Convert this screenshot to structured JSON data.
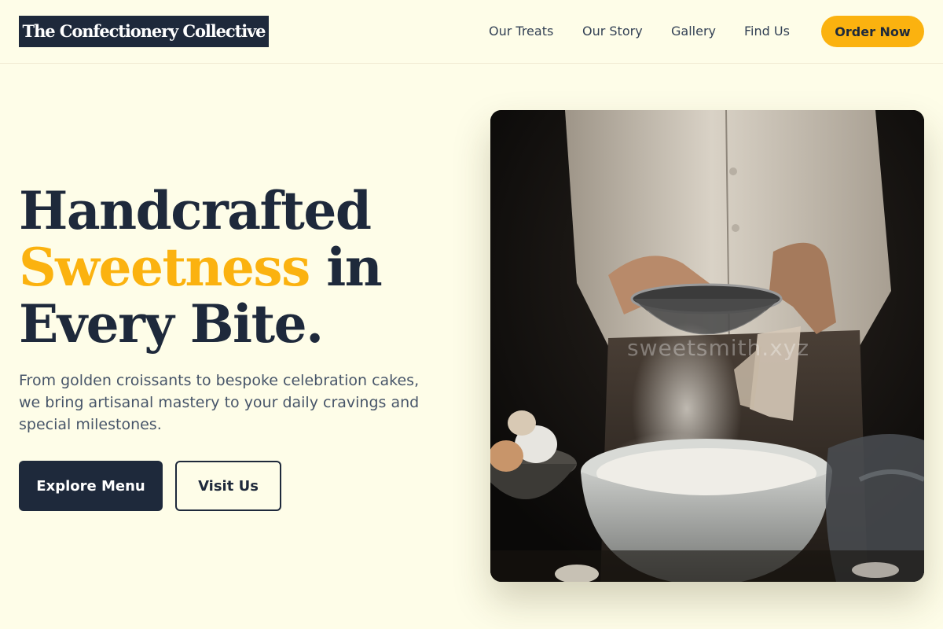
{
  "brand": {
    "name": "The Confectionery Collective"
  },
  "nav": {
    "links": [
      "Our Treats",
      "Our Story",
      "Gallery",
      "Find Us"
    ],
    "cta": "Order Now"
  },
  "hero": {
    "title_line1": "Handcrafted",
    "title_accent": "Sweetness",
    "title_line2_rest": " in",
    "title_line3": "Every Bite.",
    "description": "From golden croissants to bespoke celebration cakes, we bring artisanal mastery to your daily cravings and special milestones.",
    "primary_button": "Explore Menu",
    "secondary_button": "Visit Us",
    "image_watermark": "sweetsmith.xyz"
  },
  "colors": {
    "background": "#fefde8",
    "navy": "#1e293b",
    "accent": "#fbb20f"
  }
}
